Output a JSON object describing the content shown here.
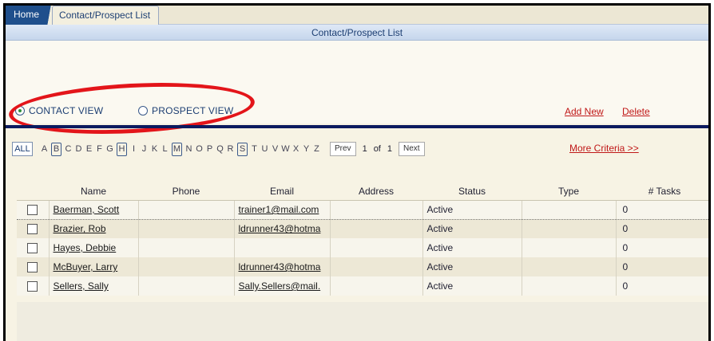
{
  "tabs": {
    "home": "Home",
    "active": "Contact/Prospect List"
  },
  "page_title": "Contact/Prospect List",
  "views": {
    "contact": "CONTACT VIEW",
    "prospect": "PROSPECT VIEW",
    "selected": "contact"
  },
  "actions": {
    "add_new": "Add New",
    "delete": "Delete",
    "more_criteria": "More Criteria >>"
  },
  "alpha": {
    "all": "ALL",
    "letters": [
      "A",
      "B",
      "C",
      "D",
      "E",
      "F",
      "G",
      "H",
      "I",
      "J",
      "K",
      "L",
      "M",
      "N",
      "O",
      "P",
      "Q",
      "R",
      "S",
      "T",
      "U",
      "V",
      "W",
      "X",
      "Y",
      "Z"
    ],
    "boxed": [
      "B",
      "H",
      "M",
      "S"
    ]
  },
  "pager": {
    "prev": "Prev",
    "current": "1",
    "of": "of",
    "total": "1",
    "next": "Next"
  },
  "table": {
    "headers": [
      "Name",
      "Phone",
      "Email",
      "Address",
      "Status",
      "Type",
      "# Tasks"
    ],
    "rows": [
      {
        "name": "Baerman, Scott",
        "phone": "",
        "email": "trainer1@mail.com",
        "address": "",
        "status": "Active",
        "type": "",
        "tasks": "0"
      },
      {
        "name": "Brazier, Rob",
        "phone": "",
        "email": "ldrunner43@hotma",
        "address": "",
        "status": "Active",
        "type": "",
        "tasks": "0"
      },
      {
        "name": "Hayes, Debbie",
        "phone": "",
        "email": "",
        "address": "",
        "status": "Active",
        "type": "",
        "tasks": "0"
      },
      {
        "name": "McBuyer, Larry",
        "phone": "",
        "email": "ldrunner43@hotma",
        "address": "",
        "status": "Active",
        "type": "",
        "tasks": "0"
      },
      {
        "name": "Sellers, Sally",
        "phone": "",
        "email": "Sally.Sellers@mail.",
        "address": "",
        "status": "Active",
        "type": "",
        "tasks": "0"
      }
    ]
  },
  "colors": {
    "accent_navy": "#0c1a60",
    "link_red": "#c01818",
    "annotation_red": "#e3151a",
    "tab_blue": "#1f4f8c"
  }
}
